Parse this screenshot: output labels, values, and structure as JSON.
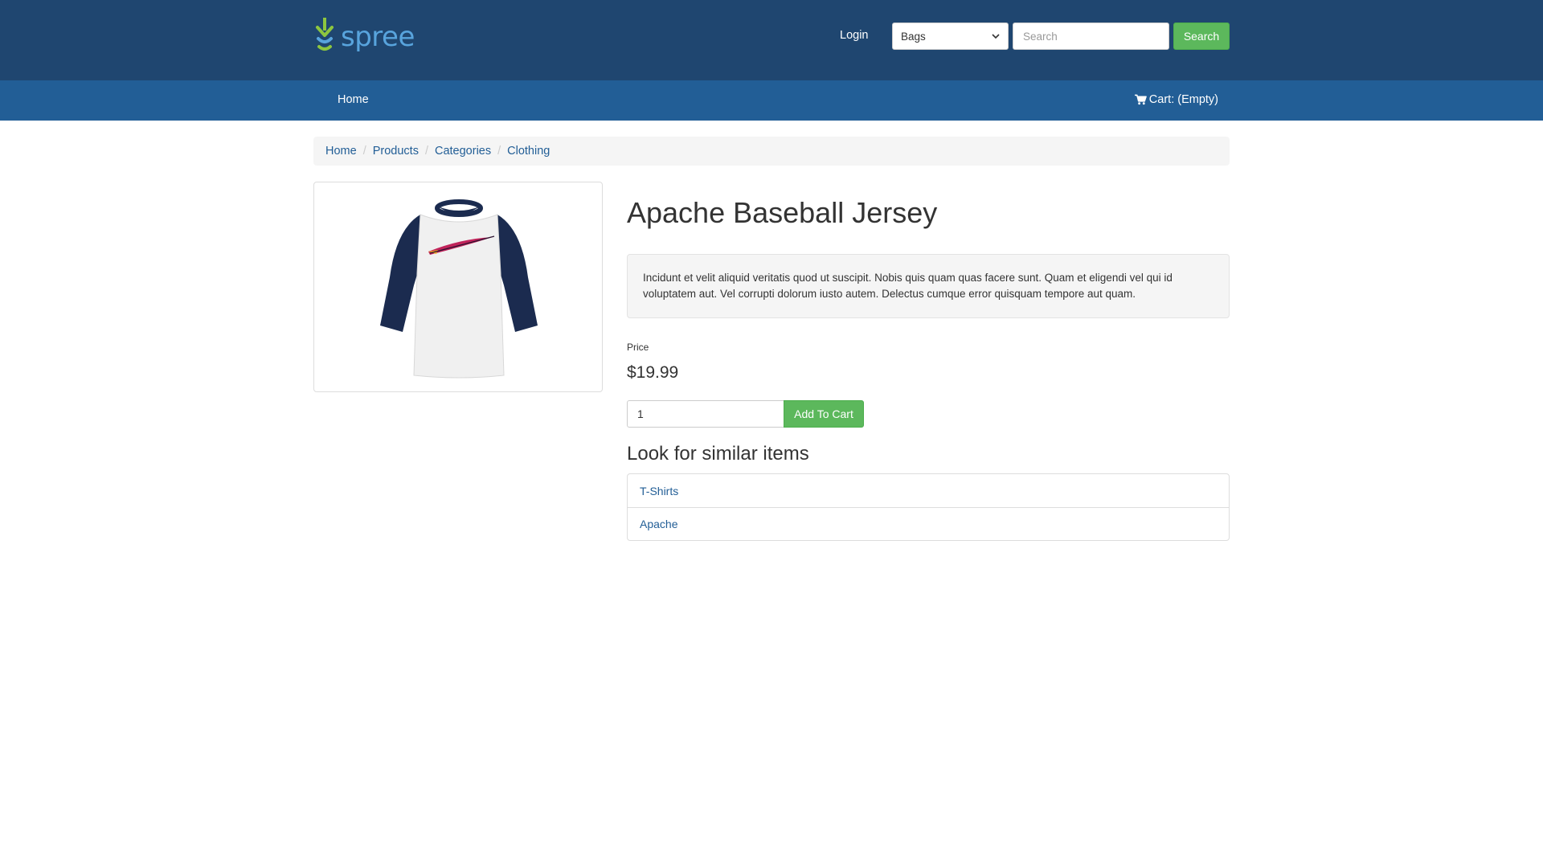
{
  "brand": {
    "name": "spree"
  },
  "header": {
    "login_label": "Login",
    "taxon_select_value": "Bags",
    "search_placeholder": "Search",
    "search_button_label": "Search"
  },
  "navbar": {
    "home_label": "Home",
    "cart_label": "Cart: (Empty)",
    "cart_icon": "shopping-cart-icon"
  },
  "breadcrumb": [
    {
      "label": "Home"
    },
    {
      "label": "Products"
    },
    {
      "label": "Categories"
    },
    {
      "label": "Clothing"
    }
  ],
  "product": {
    "title": "Apache Baseball Jersey",
    "description": "Incidunt et velit aliquid veritatis quod ut suscipit. Nobis quis quam quas facere sunt. Quam et eligendi vel qui id voluptatem aut. Vel corrupti dolorum iusto autem. Delectus cumque error quisquam tempore aut quam.",
    "price_label": "Price",
    "price": "$19.99",
    "quantity": "1",
    "add_to_cart_label": "Add To Cart"
  },
  "similar": {
    "heading": "Look for similar items",
    "items": [
      {
        "label": "T-Shirts"
      },
      {
        "label": "Apache"
      }
    ]
  },
  "colors": {
    "header_bg": "#1f4670",
    "navbar_bg": "#225e96",
    "button_green": "#5cb85c",
    "link_blue": "#225e96"
  }
}
